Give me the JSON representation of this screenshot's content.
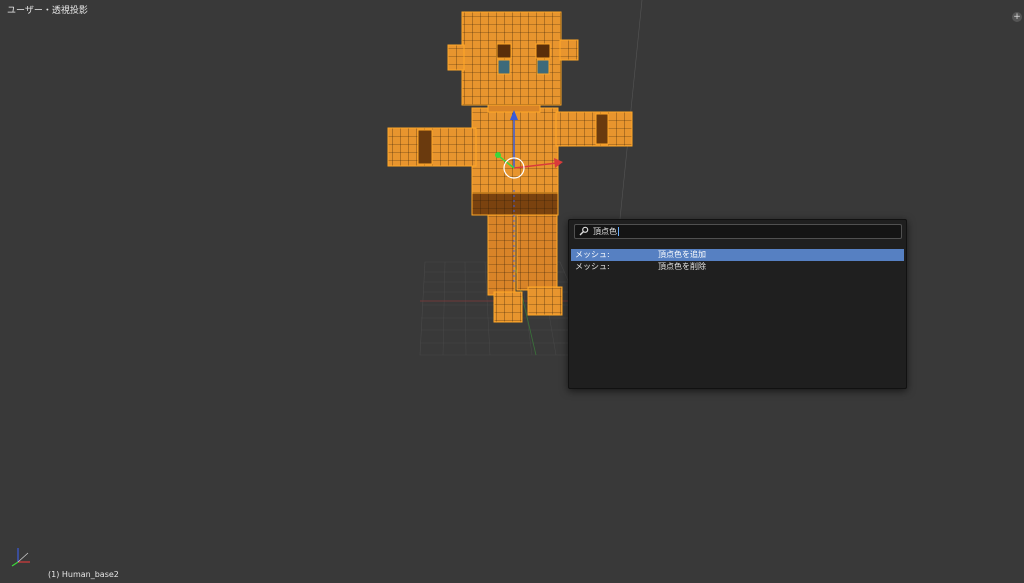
{
  "viewport": {
    "view_label": "ユーザー・透視投影",
    "object_label": "(1) Human_base2",
    "add_label": "+"
  },
  "search": {
    "query": "頂点色",
    "results": [
      {
        "category": "メッシュ:",
        "name": "頂点色を追加",
        "active": true
      },
      {
        "category": "メッシュ:",
        "name": "頂点色を削除",
        "active": false
      }
    ]
  },
  "colors": {
    "background": "#393939",
    "mesh_fill": "#e8952e",
    "mesh_wire": "#ffa726",
    "mesh_dark": "#6a3a0e",
    "highlight": "#5680c2",
    "popup_bg": "#1f1f1f"
  },
  "icons": {
    "search": "search-icon",
    "axes": "axes-gizmo-icon",
    "add": "plus-icon"
  }
}
